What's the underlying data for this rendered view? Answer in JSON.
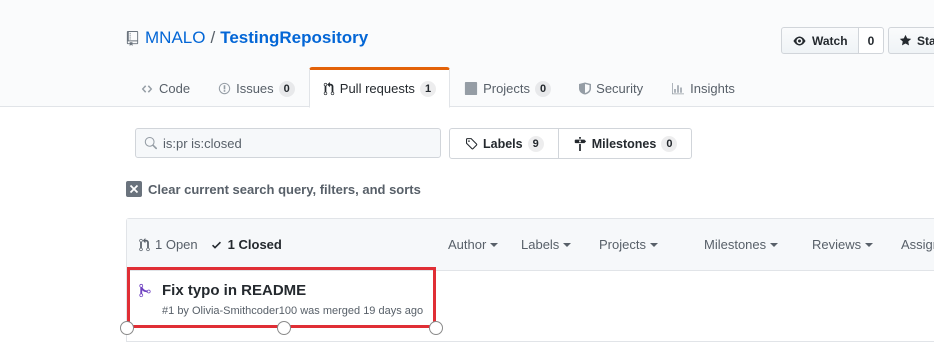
{
  "header": {
    "owner": "MNALO",
    "separator": "/",
    "repo": "TestingRepository",
    "watch_label": "Watch",
    "watch_count": "0",
    "star_label": "Star"
  },
  "tabs": [
    {
      "label": "Code",
      "icon": "code-icon"
    },
    {
      "label": "Issues",
      "count": "0",
      "icon": "issue-icon"
    },
    {
      "label": "Pull requests",
      "count": "1",
      "icon": "pull-request-icon",
      "selected": true
    },
    {
      "label": "Projects",
      "count": "0",
      "icon": "project-icon"
    },
    {
      "label": "Security",
      "icon": "shield-icon"
    },
    {
      "label": "Insights",
      "icon": "graph-icon"
    }
  ],
  "search": {
    "value": "is:pr is:closed"
  },
  "labels_button": {
    "label": "Labels",
    "count": "9"
  },
  "milestones_button": {
    "label": "Milestones",
    "count": "0"
  },
  "clear_filters": "Clear current search query, filters, and sorts",
  "list_header": {
    "open": "1 Open",
    "closed": "1 Closed",
    "filters": [
      "Author",
      "Labels",
      "Projects",
      "Milestones",
      "Reviews",
      "Assignee"
    ]
  },
  "pull_requests": [
    {
      "title": "Fix typo in README",
      "number": "#1",
      "by": "by",
      "author": "Olivia-Smithcoder100",
      "status": "was merged 19 days ago"
    }
  ],
  "colors": {
    "accent": "#e36209",
    "link": "#0366d6",
    "merged": "#6f42c1",
    "highlight": "#e02e35"
  }
}
